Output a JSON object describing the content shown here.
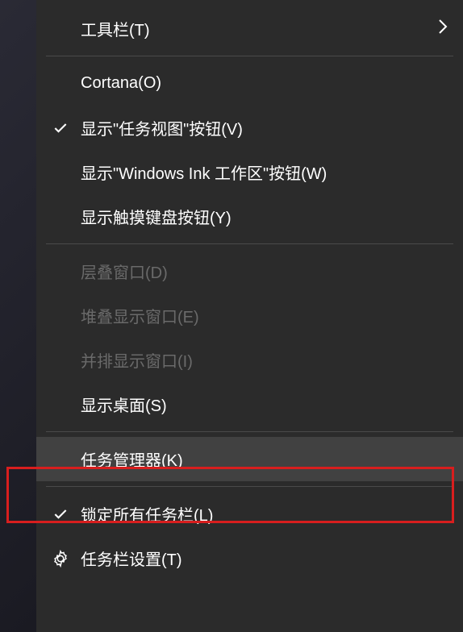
{
  "menu": {
    "items": [
      {
        "label": "工具栏(T)",
        "has_submenu": true,
        "checked": false,
        "icon": null,
        "disabled": false,
        "highlighted": false
      },
      {
        "separator": true
      },
      {
        "label": "Cortana(O)",
        "has_submenu": false,
        "checked": false,
        "icon": null,
        "disabled": false,
        "highlighted": false
      },
      {
        "label": "显示\"任务视图\"按钮(V)",
        "has_submenu": false,
        "checked": true,
        "icon": "check",
        "disabled": false,
        "highlighted": false
      },
      {
        "label": "显示\"Windows Ink 工作区\"按钮(W)",
        "has_submenu": false,
        "checked": false,
        "icon": null,
        "disabled": false,
        "highlighted": false
      },
      {
        "label": "显示触摸键盘按钮(Y)",
        "has_submenu": false,
        "checked": false,
        "icon": null,
        "disabled": false,
        "highlighted": false
      },
      {
        "separator": true
      },
      {
        "label": "层叠窗口(D)",
        "has_submenu": false,
        "checked": false,
        "icon": null,
        "disabled": true,
        "highlighted": false
      },
      {
        "label": "堆叠显示窗口(E)",
        "has_submenu": false,
        "checked": false,
        "icon": null,
        "disabled": true,
        "highlighted": false
      },
      {
        "label": "并排显示窗口(I)",
        "has_submenu": false,
        "checked": false,
        "icon": null,
        "disabled": true,
        "highlighted": false
      },
      {
        "label": "显示桌面(S)",
        "has_submenu": false,
        "checked": false,
        "icon": null,
        "disabled": false,
        "highlighted": false
      },
      {
        "separator": true
      },
      {
        "label": "任务管理器(K)",
        "has_submenu": false,
        "checked": false,
        "icon": null,
        "disabled": false,
        "highlighted": true
      },
      {
        "separator": true
      },
      {
        "label": "锁定所有任务栏(L)",
        "has_submenu": false,
        "checked": true,
        "icon": "check",
        "disabled": false,
        "highlighted": false
      },
      {
        "label": "任务栏设置(T)",
        "has_submenu": false,
        "checked": false,
        "icon": "gear",
        "disabled": false,
        "highlighted": false
      }
    ]
  }
}
